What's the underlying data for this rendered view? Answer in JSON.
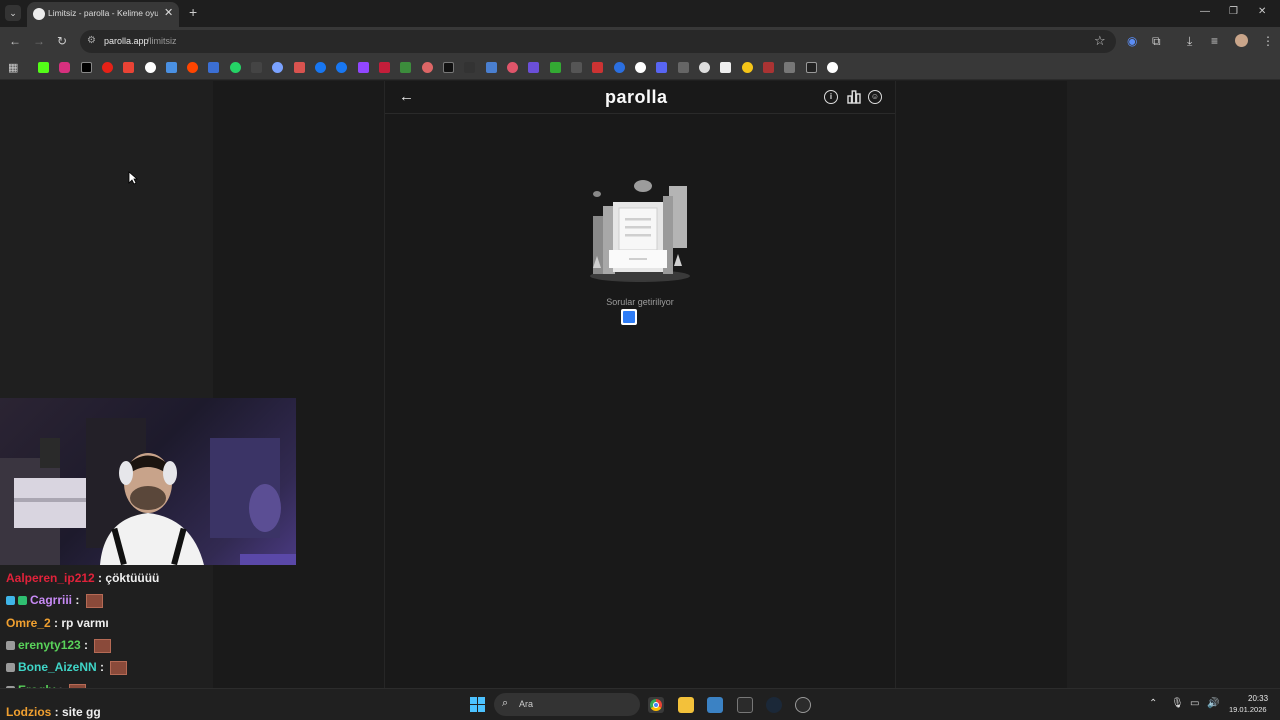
{
  "browser": {
    "tab_title": "Limitsiz - parolla - Kelime oyunu",
    "url_host": "parolla.app",
    "url_path": "/limitsiz"
  },
  "app": {
    "title": "parolla",
    "loading_text": "Sorular getiriliyor"
  },
  "chat": {
    "messages": [
      {
        "user": "Aalperen_ip212",
        "text": "çöktüüüü",
        "color": "#e0223a",
        "emote": false
      },
      {
        "user": "Cagrriii",
        "text": "",
        "color": "#c78af5",
        "emote": true
      },
      {
        "user": "Omre_2",
        "text": "rp varmı",
        "color": "#f0a030",
        "emote": false
      },
      {
        "user": "erenyty123",
        "text": "",
        "color": "#59d35a",
        "emote": true
      },
      {
        "user": "Bone_AizeNN",
        "text": "",
        "color": "#3fd6c8",
        "emote": true
      },
      {
        "user": "Eroglv",
        "text": "",
        "color": "#59d35a",
        "emote": true
      },
      {
        "user": "Lodzios",
        "text": "site gg",
        "color": "#f0a030",
        "emote": false
      }
    ]
  },
  "taskbar": {
    "search_placeholder": "Ara",
    "time": "20:33",
    "date": "19.01.2026"
  },
  "colors": {
    "page_bg": "#1f1f1f",
    "app_bg": "#191919",
    "accent_blue": "#2f7df6"
  }
}
